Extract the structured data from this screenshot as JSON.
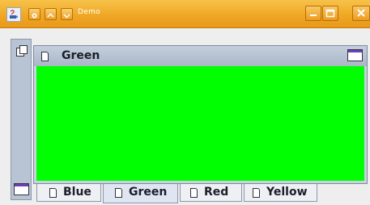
{
  "window": {
    "title": "Demo"
  },
  "content_panel": {
    "title": "Green",
    "fill_color": "#00ff00"
  },
  "tabs": [
    {
      "label": "Blue",
      "selected": false
    },
    {
      "label": "Green",
      "selected": true
    },
    {
      "label": "Red",
      "selected": false
    },
    {
      "label": "Yellow",
      "selected": false
    }
  ],
  "icons": {
    "app": "java-coffee-cup-icon",
    "doc": "document-icon",
    "maximize": "maximize-window-icon",
    "restore": "restore-window-icon"
  }
}
